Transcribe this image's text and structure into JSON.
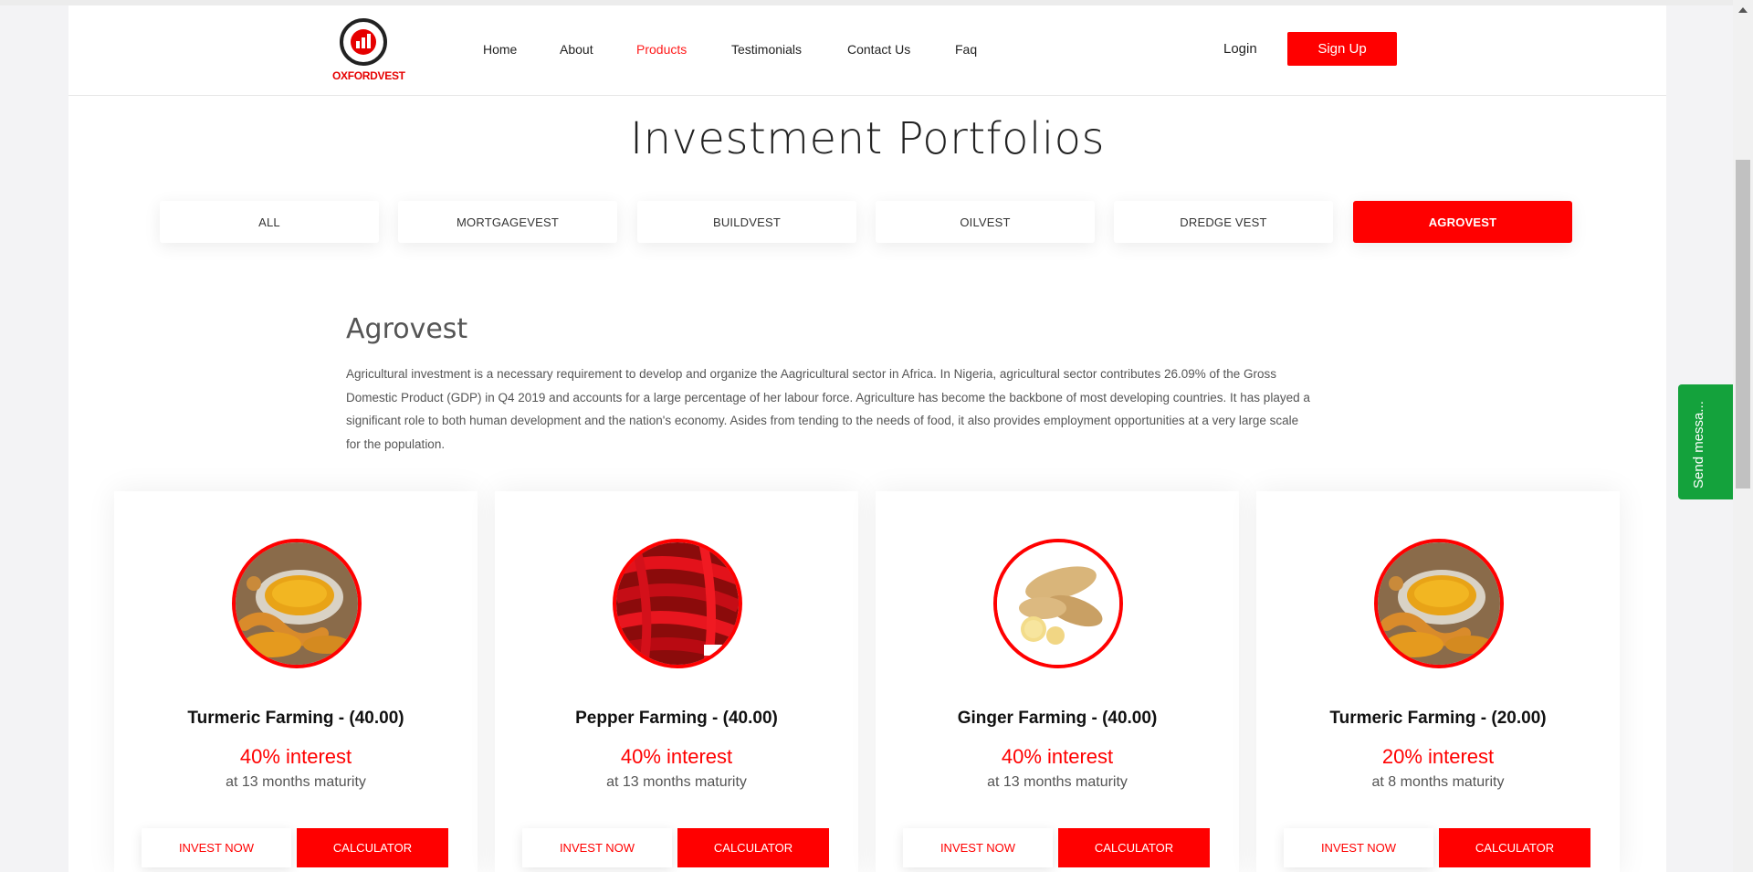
{
  "brand": {
    "logo_text_a": "OXFORD",
    "logo_text_b": "VEST",
    "accent": "#ff0000"
  },
  "nav": {
    "items": [
      "Home",
      "About",
      "Products",
      "Testimonials",
      "Contact Us",
      "Faq"
    ],
    "active": "Products",
    "login": "Login",
    "signup": "Sign Up"
  },
  "title": "Investment Portfolios",
  "tabs": [
    "ALL",
    "MORTGAGEVEST",
    "BUILDVEST",
    "OILVEST",
    "DREDGE VEST",
    "AGROVEST"
  ],
  "active_tab": "AGROVEST",
  "section": {
    "title": "Agrovest",
    "description": "Agricultural investment is a necessary requirement to develop and organize the Aagricultural sector in Africa. In Nigeria, agricultural sector contributes 26.09% of the Gross Domestic Product (GDP) in Q4 2019 and accounts for a large percentage of her labour force. Agriculture has become the backbone of most developing countries. It has played a significant role to both human development and the nation's economy. Asides from tending to the needs of food, it also provides employment opportunities at a very large scale for the population."
  },
  "cards": [
    {
      "title": "Turmeric Farming - (40.00)",
      "interest": "40% interest",
      "maturity": "at 13 months maturity",
      "invest_label": "INVEST NOW",
      "calc_label": "CALCULATOR",
      "image": "turmeric-image"
    },
    {
      "title": "Pepper Farming - (40.00)",
      "interest": "40% interest",
      "maturity": "at 13 months maturity",
      "invest_label": "INVEST NOW",
      "calc_label": "CALCULATOR",
      "image": "pepper-image"
    },
    {
      "title": "Ginger Farming - (40.00)",
      "interest": "40% interest",
      "maturity": "at 13 months maturity",
      "invest_label": "INVEST NOW",
      "calc_label": "CALCULATOR",
      "image": "ginger-image"
    },
    {
      "title": "Turmeric Farming - (20.00)",
      "interest": "20% interest",
      "maturity": "at 8 months maturity",
      "invest_label": "INVEST NOW",
      "calc_label": "CALCULATOR",
      "image": "turmeric-image"
    }
  ],
  "chat_widget": {
    "label": "Send messa...",
    "color": "#14a23c"
  }
}
